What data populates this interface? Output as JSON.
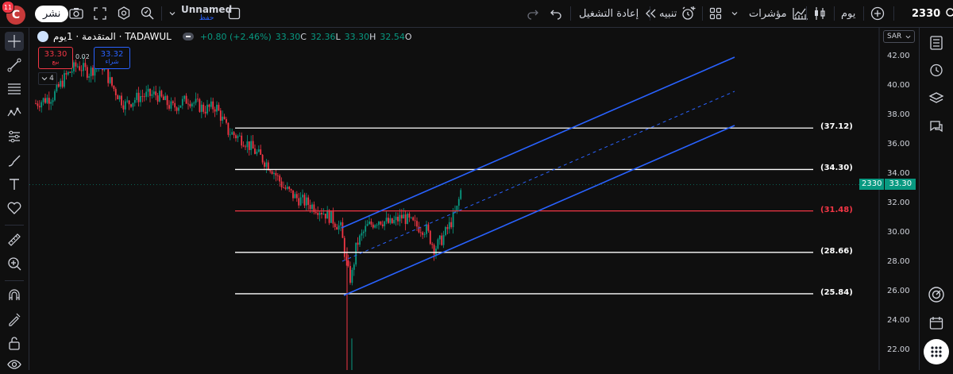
{
  "topbar": {
    "avatar_letter": "C",
    "notification_count": "11",
    "share_label": "نشر",
    "layout_name": "Unnamed",
    "layout_subtitle": "حفظ",
    "replay_label": "إعادة التشغيل",
    "alert_label": "تنبيه",
    "indicators_label": "مؤشرات",
    "interval_label": "يوم",
    "symbol_search": "2330"
  },
  "legend": {
    "title": "المتقدمة · 1يوم · TADAWUL",
    "change": "+0.80 (+2.46%)",
    "close_label": "C",
    "close_value": "33.30",
    "low_label": "L",
    "low_value": "32.36",
    "high_label": "H",
    "high_value": "33.30",
    "open_label": "O",
    "open_value": "32.54",
    "sell_price": "33.30",
    "sell_label": "بيع",
    "spread": "0.02",
    "buy_price": "33.32",
    "buy_label": "شراء",
    "indicator_count": "4"
  },
  "price_axis": {
    "currency": "SAR",
    "ticks": [
      "42.00",
      "40.00",
      "38.00",
      "36.00",
      "34.00",
      "32.00",
      "30.00",
      "28.00",
      "26.00",
      "24.00",
      "22.00"
    ],
    "current_symbol": "2330",
    "current_price": "33.30"
  },
  "levels": [
    {
      "label": "(37.12)",
      "value": 37.12,
      "color": "#ffffff"
    },
    {
      "label": "(34.30)",
      "value": 34.3,
      "color": "#ffffff"
    },
    {
      "label": "(31.48)",
      "value": 31.48,
      "color": "#f23645"
    },
    {
      "label": "(28.66)",
      "value": 28.66,
      "color": "#ffffff"
    },
    {
      "label": "(25.84)",
      "value": 25.84,
      "color": "#ffffff"
    }
  ],
  "colors": {
    "up": "#089981",
    "down": "#f23645",
    "channel": "#2962ff",
    "accent": "#2962ff",
    "price_tag": "#089981"
  },
  "icons": {
    "left_toolbar": [
      "crosshair-icon",
      "trend-line-icon",
      "fib-icon",
      "pattern-icon",
      "prediction-icon",
      "brush-icon",
      "text-icon",
      "heart-icon",
      "ruler-icon",
      "zoom-in-icon",
      "magnet-icon",
      "stay-drawing-icon",
      "lock-icon",
      "eye-icon"
    ],
    "right_toolbar": [
      "watchlist-icon",
      "alerts-clock-icon",
      "layers-icon",
      "chat-icon",
      "target-icon",
      "calendar-icon",
      "apps-grid-icon"
    ]
  }
}
